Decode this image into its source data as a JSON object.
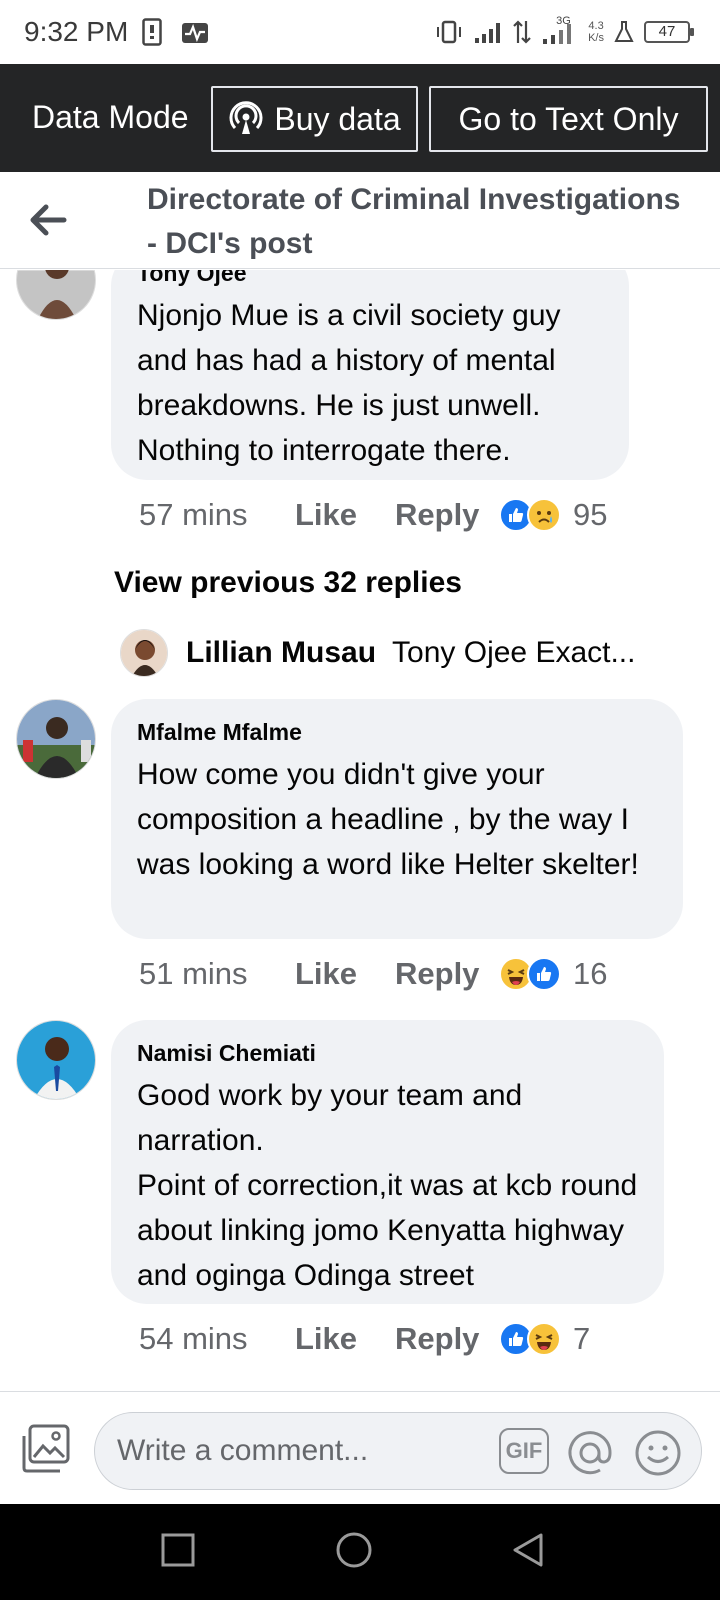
{
  "status_bar": {
    "time": "9:32 PM",
    "network": "3G",
    "speed_value": "4.3",
    "speed_unit": "K/s",
    "battery": "47"
  },
  "data_bar": {
    "label": "Data Mode",
    "buy_data": "Buy data",
    "text_only": "Go to Text Only",
    "background": "#242526"
  },
  "header": {
    "title": "Directorate of Criminal Investigations - DCI's post"
  },
  "comments": [
    {
      "author": "Tony Ojee",
      "text": "Njonjo Mue is a civil society guy and has had a history of mental breakdowns. He is just unwell. Nothing to interrogate there.",
      "time": "57 mins",
      "like": "Like",
      "reply": "Reply",
      "reactions": [
        "like-icon",
        "sad-icon"
      ],
      "count": "95"
    },
    {
      "author": "Mfalme Mfalme",
      "text": "How come you didn't give your composition a headline , by the way I was looking a word like Helter skelter!",
      "time": "51 mins",
      "like": "Like",
      "reply": "Reply",
      "reactions": [
        "haha-icon",
        "like-icon"
      ],
      "count": "16"
    },
    {
      "author": "Namisi Chemiati",
      "text_lines": [
        "Good work by your team and narration.",
        "Point of correction,it was at kcb round about linking jomo Kenyatta highway and oginga Odinga street"
      ],
      "time": "54 mins",
      "like": "Like",
      "reply": "Reply",
      "reactions": [
        "like-icon",
        "haha-icon"
      ],
      "count": "7"
    }
  ],
  "view_previous": "View previous 32 replies",
  "latest_reply": {
    "author": "Lillian Musau",
    "preview": "Tony Ojee Exact..."
  },
  "composer": {
    "placeholder": "Write a comment...",
    "gif_label": "GIF"
  },
  "colors": {
    "like_blue": "#1877f2",
    "bubble": "#f0f2f5",
    "secondary_text": "#65676b"
  }
}
